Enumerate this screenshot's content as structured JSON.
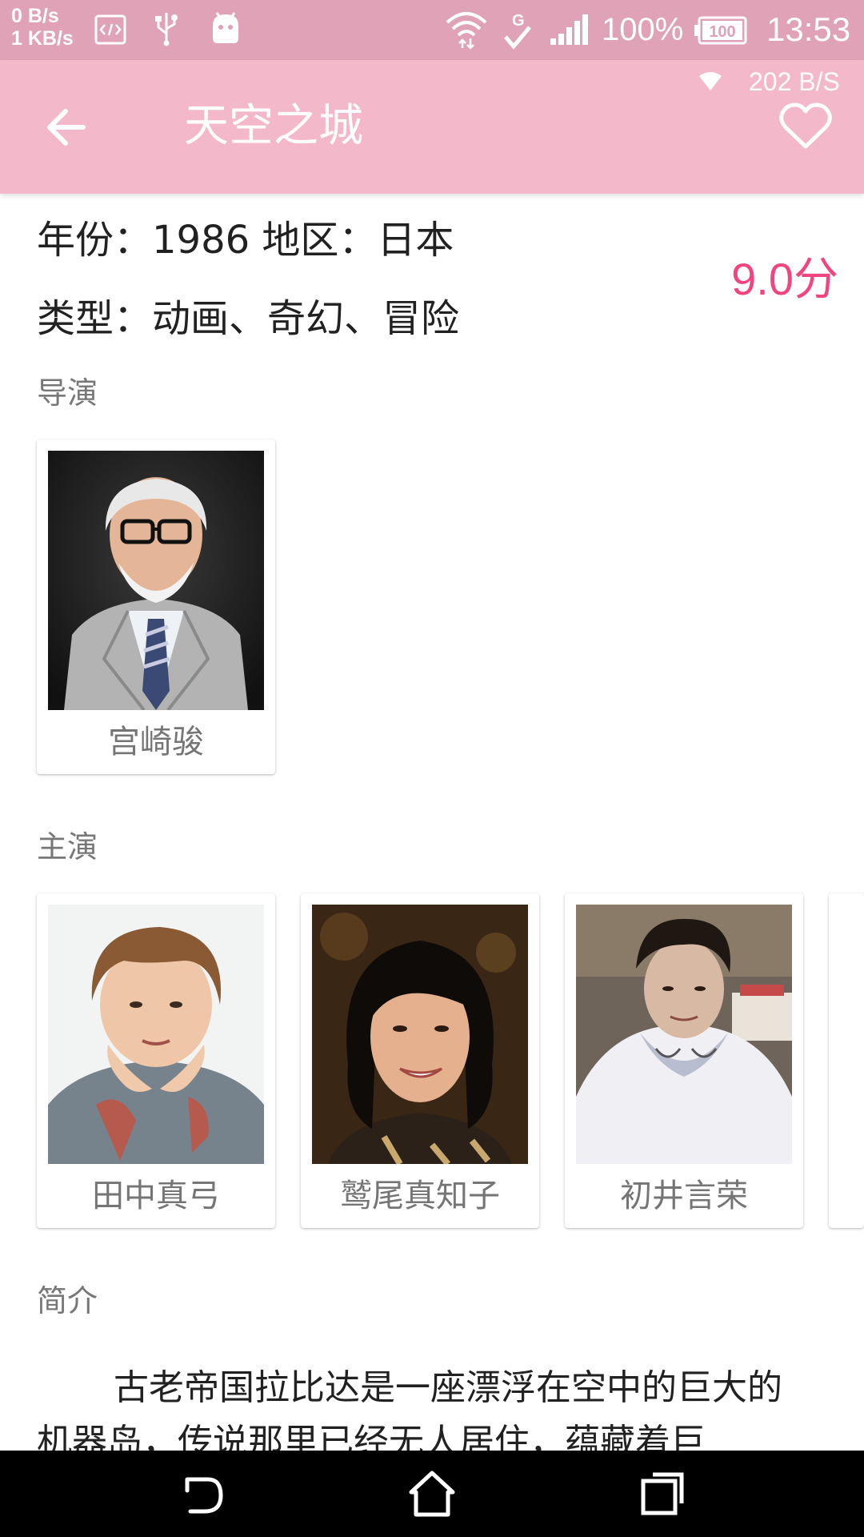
{
  "status_bar": {
    "speed_up": "0 B/s",
    "speed_down": "1 KB/s",
    "battery_pct": "100%",
    "battery_level": "100",
    "time": "13:53",
    "icons": [
      "code-icon",
      "usb-icon",
      "android-icon",
      "wifi-icon",
      "g-network-icon",
      "signal-icon",
      "battery-icon"
    ]
  },
  "app_bar": {
    "title": "天空之城",
    "net_speed": "202 B/S",
    "accent": "#f4b8cb"
  },
  "movie": {
    "year_line": "年份：1986  地区：日本",
    "genre_line": "类型：动画、奇幻、冒险",
    "score": "9.0分",
    "score_color": "#f0457f"
  },
  "director": {
    "label": "导演",
    "people": [
      {
        "name": "宫崎骏"
      }
    ]
  },
  "cast": {
    "label": "主演",
    "people": [
      {
        "name": "田中真弓"
      },
      {
        "name": "鹫尾真知子"
      },
      {
        "name": "初井言荣"
      }
    ]
  },
  "intro": {
    "label": "简介",
    "text": "古老帝国拉比达是一座漂浮在空中的巨大的机器岛，传说那里已经无人居住，蕴藏着巨"
  }
}
